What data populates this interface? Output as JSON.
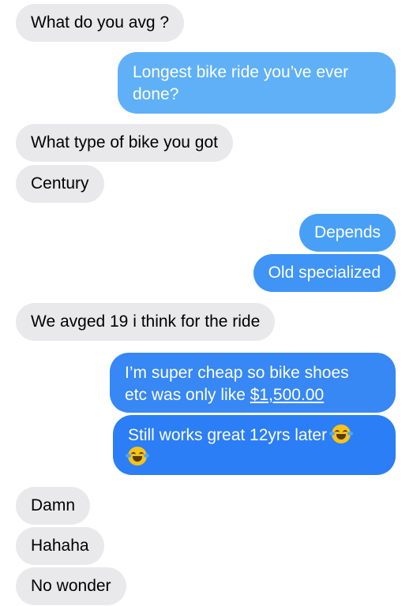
{
  "colors": {
    "incoming_bubble": "#e9e9eb",
    "outgoing_light": "#5fb0f7",
    "outgoing_dark": "#2b7ef5"
  },
  "messages": [
    {
      "side": "incoming",
      "text": "What do you avg ?"
    },
    {
      "side": "outgoing",
      "lines": [
        "Longest bike ride you’ve ever",
        "done?"
      ]
    },
    {
      "side": "incoming",
      "text": "What type of bike you got"
    },
    {
      "side": "incoming",
      "text": "Century"
    },
    {
      "side": "outgoing",
      "text": "Depends"
    },
    {
      "side": "outgoing",
      "text": "Old specialized"
    },
    {
      "side": "incoming",
      "text": "We avged 19 i think for the ride"
    },
    {
      "side": "outgoing",
      "line1": "I’m super cheap so bike shoes",
      "line2_prefix": "etc was only like ",
      "line2_link": "$1,500.00"
    },
    {
      "side": "outgoing",
      "text": "Still works great 12yrs later",
      "emoji": "rolling-on-the-floor-laughing"
    },
    {
      "side": "incoming",
      "text": "Damn"
    },
    {
      "side": "incoming",
      "text": "Hahaha"
    },
    {
      "side": "incoming",
      "text": "No wonder"
    }
  ]
}
